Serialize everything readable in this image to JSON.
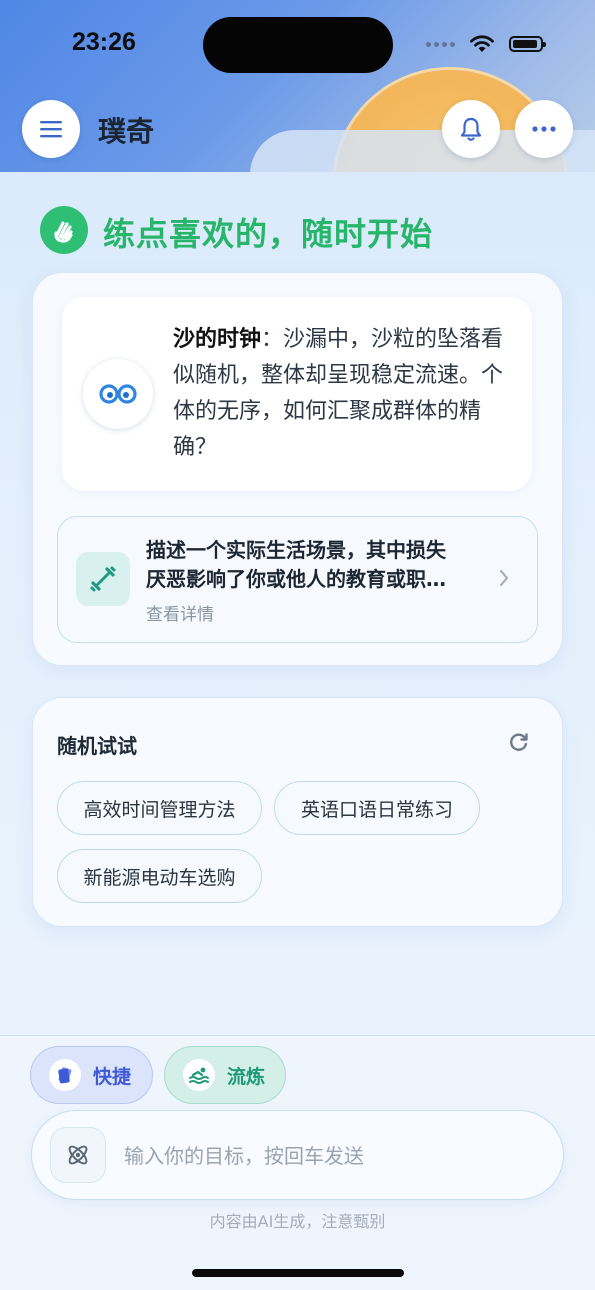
{
  "status_bar": {
    "time": "23:26"
  },
  "header": {
    "title": "璞奇"
  },
  "greeting": {
    "text": "练点喜欢的，随时开始"
  },
  "quote": {
    "title": "沙的时钟",
    "separator": "：",
    "body": "沙漏中，沙粒的坠落看似随机，整体却呈现稳定流速。个体的无序，如何汇聚成群体的精确？"
  },
  "task": {
    "title_line1": "描述一个实际生活场景，其中损失",
    "title_line2": "厌恶影响了你或他人的教育或职…",
    "detail_label": "查看详情"
  },
  "random": {
    "title": "随机试试",
    "chips": [
      "高效时间管理方法",
      "英语口语日常练习",
      "新能源电动车选购"
    ]
  },
  "modes": {
    "quick_label": "快捷",
    "drill_label": "流炼"
  },
  "input": {
    "placeholder": "输入你的目标，按回车发送",
    "value": ""
  },
  "footer": {
    "disclaimer": "内容由AI生成，注意甄别"
  },
  "colors": {
    "accent_green": "#27b56a",
    "accent_blue": "#3f5ad6",
    "accent_teal": "#1e9a78",
    "header_blue": "#4f86e6"
  }
}
